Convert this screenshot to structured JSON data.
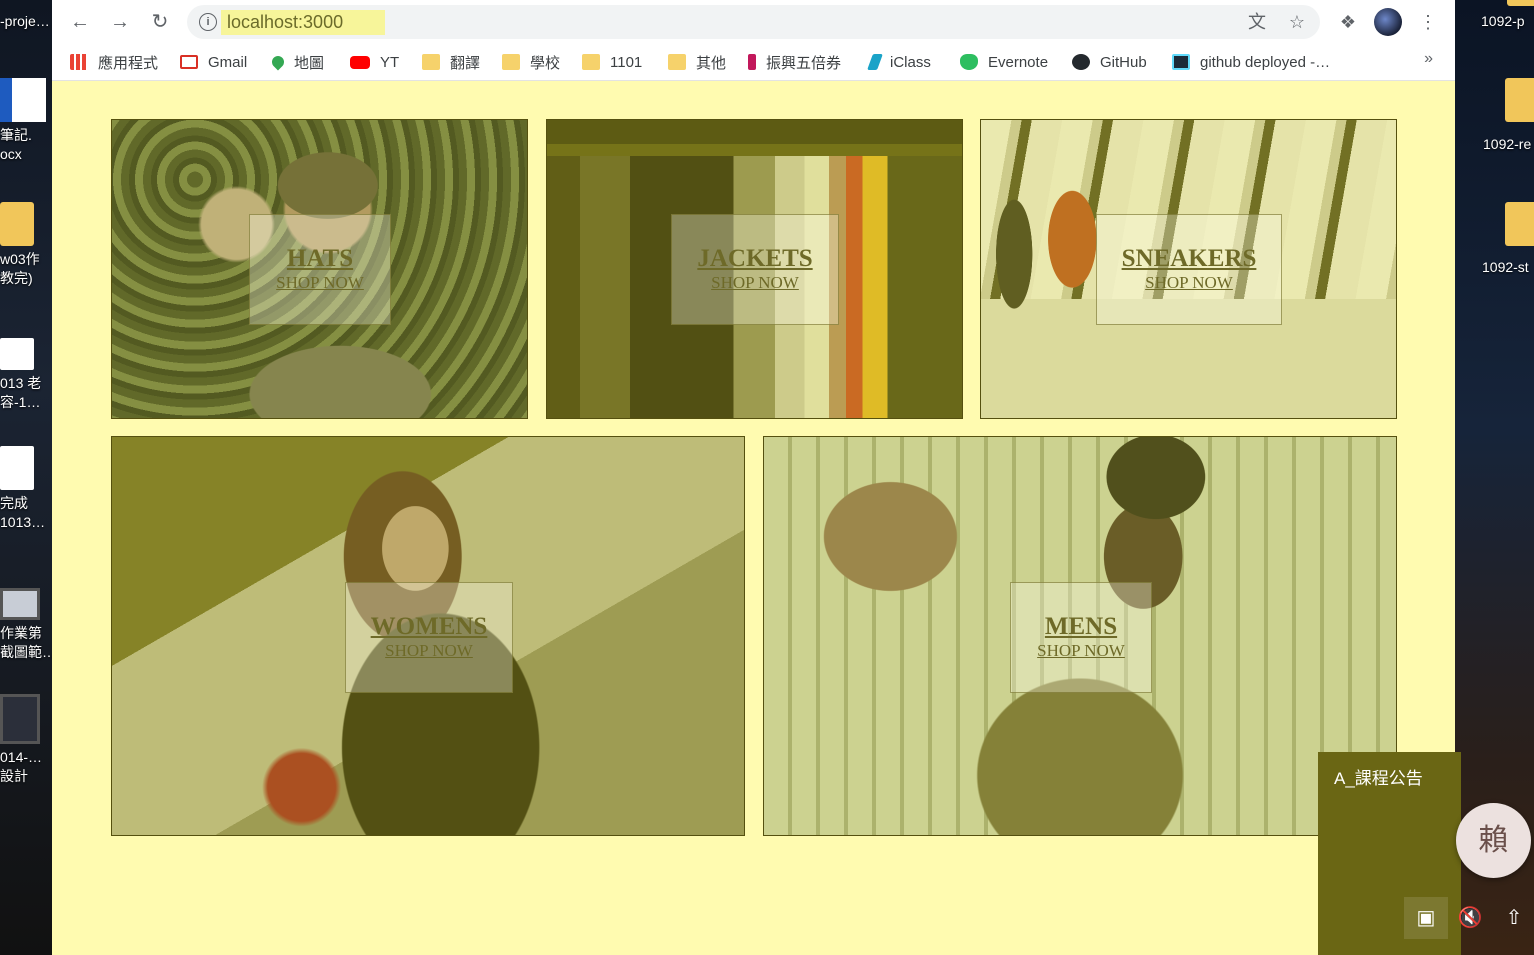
{
  "desktop": {
    "left_icons": [
      {
        "line1": "-proje…",
        "line2": ""
      },
      {
        "line1": "筆記.",
        "line2": "ocx"
      },
      {
        "line1": "w03作",
        "line2": "教完)"
      },
      {
        "line1": "013 老",
        "line2": "容-1…"
      },
      {
        "line1": "完成",
        "line2": "1013…"
      },
      {
        "line1": "作業第",
        "line2": "截圖範…"
      },
      {
        "line1": "014-…",
        "line2": "設計"
      }
    ],
    "right_icons": [
      {
        "label": "1092-p"
      },
      {
        "label": "1092-re"
      },
      {
        "label": "1092-st"
      }
    ]
  },
  "browser": {
    "url": "localhost:3000",
    "bookmarks": [
      {
        "label": "應用程式",
        "icon": "apps-grid-icon",
        "color": "#e8453c"
      },
      {
        "label": "Gmail",
        "icon": "gmail-icon",
        "color": "#d93025"
      },
      {
        "label": "地圖",
        "icon": "maps-icon",
        "color": "#34a853"
      },
      {
        "label": "YT",
        "icon": "youtube-icon",
        "color": "#ff0000"
      },
      {
        "label": "翻譯",
        "icon": "folder-icon",
        "color": "#f6d26b"
      },
      {
        "label": "學校",
        "icon": "folder-icon",
        "color": "#f6d26b"
      },
      {
        "label": "1101",
        "icon": "folder-icon",
        "color": "#f6d26b"
      },
      {
        "label": "其他",
        "icon": "folder-icon",
        "color": "#f6d26b"
      },
      {
        "label": "振興五倍券",
        "icon": "voucher-icon",
        "color": "#c2185b"
      },
      {
        "label": "iClass",
        "icon": "iclass-icon",
        "color": "#1aa3c8"
      },
      {
        "label": "Evernote",
        "icon": "evernote-icon",
        "color": "#2dbe60"
      },
      {
        "label": "GitHub",
        "icon": "github-icon",
        "color": "#24292e"
      },
      {
        "label": "github deployed -…",
        "icon": "react-icon",
        "color": "#1b2b3a"
      }
    ],
    "more_label": "»"
  },
  "directory": {
    "sections": [
      {
        "title": "HATS",
        "subtitle": "SHOP NOW"
      },
      {
        "title": "JACKETS",
        "subtitle": "SHOP NOW"
      },
      {
        "title": "SNEAKERS",
        "subtitle": "SHOP NOW"
      },
      {
        "title": "WOMENS",
        "subtitle": "SHOP NOW"
      },
      {
        "title": "MENS",
        "subtitle": "SHOP NOW"
      }
    ]
  },
  "popup": {
    "title": "A_課程公告",
    "avatar_char": "賴"
  },
  "colors": {
    "page_background": "#fffbb0",
    "popup_background": "#6a6614",
    "url_highlight": "#f7f59a"
  }
}
